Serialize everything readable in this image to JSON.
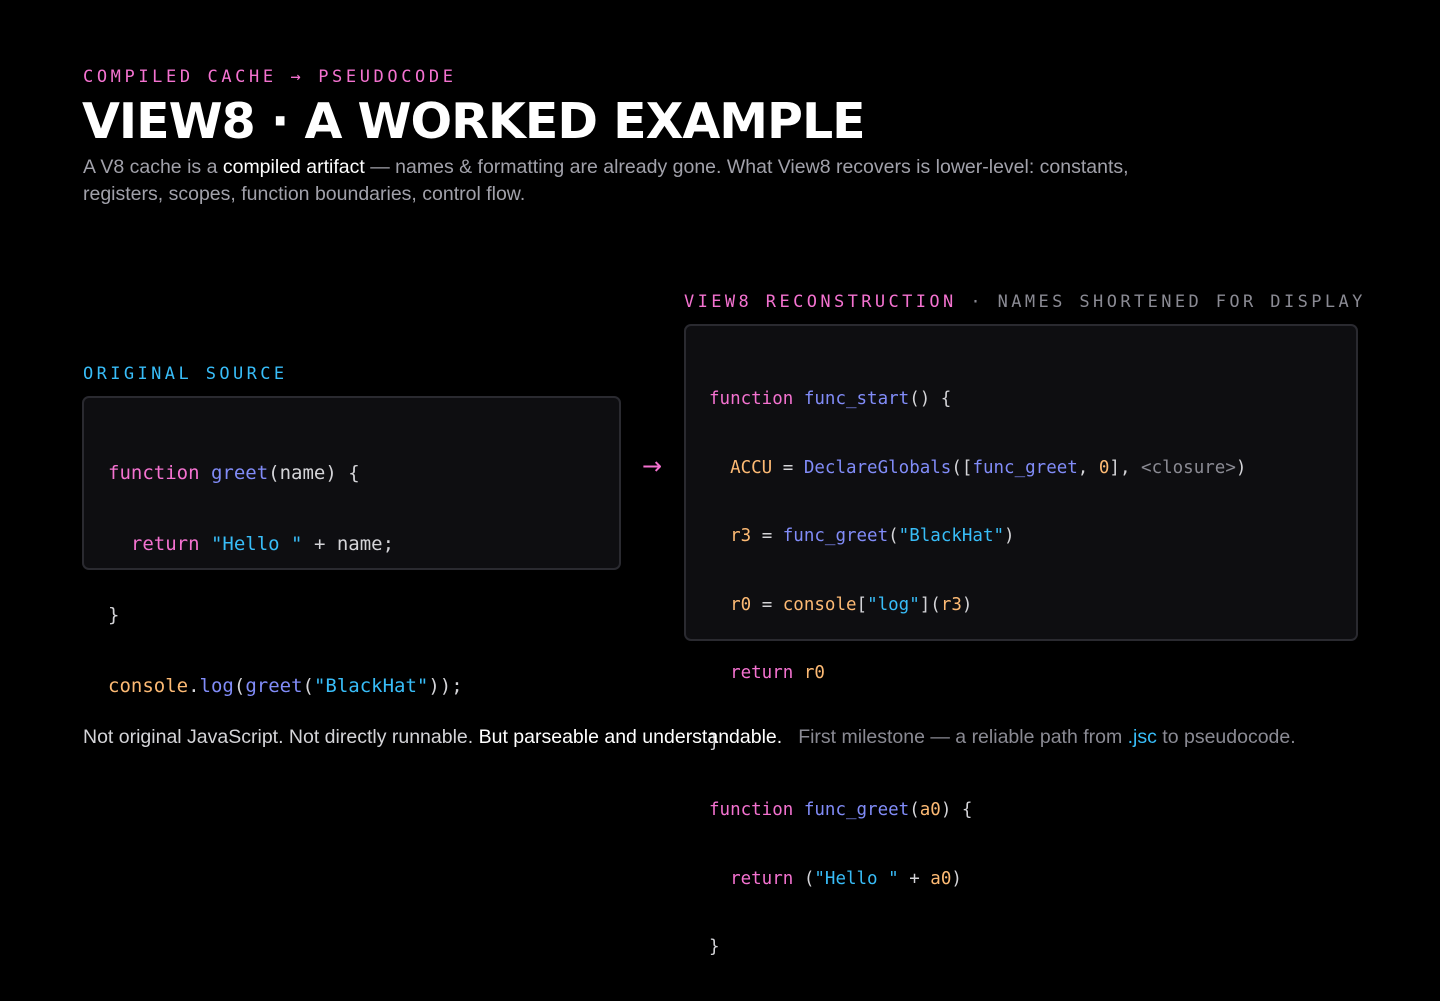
{
  "header": {
    "eyebrow": "COMPILED CACHE → PSEUDOCODE",
    "title": "VIEW8 · A WORKED EXAMPLE",
    "subtitle_pre": "A V8 cache is a ",
    "subtitle_highlight": "compiled artifact",
    "subtitle_post": " — names & formatting are already gone. What View8 recovers is lower-level: constants, registers, scopes, function boundaries, control flow."
  },
  "original": {
    "label": "ORIGINAL SOURCE",
    "code": {
      "l1_kw": "function",
      "l1_fn": "greet",
      "l1_rest": "(name) {",
      "l2_indent": "  ",
      "l2_kw": "return",
      "l2_sp": " ",
      "l2_str": "\"Hello \"",
      "l2_rest": " + name;",
      "l3": "}",
      "l4_obj": "console",
      "l4_dot": ".",
      "l4_fn": "log",
      "l4_p1": "(",
      "l4_fn2": "greet",
      "l4_p2": "(",
      "l4_str": "\"BlackHat\"",
      "l4_end": "));"
    }
  },
  "arrow": "→",
  "reconstruction": {
    "label_main": "VIEW8 RECONSTRUCTION",
    "label_sep": " · ",
    "label_note": "NAMES SHORTENED FOR DISPLAY",
    "code": {
      "l1_kw": "function",
      "l1_fn": "func_start",
      "l1_rest": "() {",
      "l2_var": "ACCU",
      "l2_eq": " = ",
      "l2_fn": "DeclareGlobals",
      "l2_p1": "([",
      "l2_fn2": "func_greet",
      "l2_comma": ", ",
      "l2_num": "0",
      "l2_p2": "], ",
      "l2_dim": "<closure>",
      "l2_end": ")",
      "l3_var": "r3",
      "l3_eq": " = ",
      "l3_fn": "func_greet",
      "l3_p1": "(",
      "l3_str": "\"BlackHat\"",
      "l3_end": ")",
      "l4_var": "r0",
      "l4_eq": " = ",
      "l4_obj": "console",
      "l4_b1": "[",
      "l4_str": "\"log\"",
      "l4_b2": "](",
      "l4_arg": "r3",
      "l4_end": ")",
      "l5_kw": "return",
      "l5_var": "r0",
      "l6": "}",
      "l7_kw": "function",
      "l7_fn": "func_greet",
      "l7_p1": "(",
      "l7_arg": "a0",
      "l7_end": ") {",
      "l8_kw": "return",
      "l8_p1": " (",
      "l8_str": "\"Hello \"",
      "l8_plus": " + ",
      "l8_arg": "a0",
      "l8_end": ")",
      "l9": "}"
    }
  },
  "footer": {
    "part1": "Not original JavaScript. Not directly runnable. ",
    "part2": "But parseable and understandable.",
    "part3_pre": "First milestone — a reliable path from ",
    "part3_ext": ".jsc",
    "part3_post": " to pseudocode."
  },
  "colors": {
    "accent_pink": "#f472d0",
    "accent_blue": "#38bdf8",
    "function_name": "#818cf8",
    "variable": "#fdba74",
    "background": "#000000",
    "panel": "#0e0e11"
  }
}
